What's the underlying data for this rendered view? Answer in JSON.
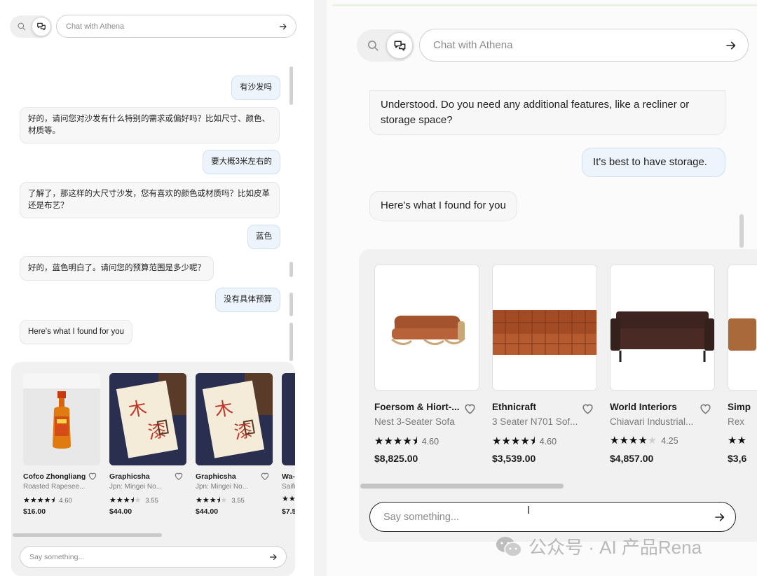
{
  "left": {
    "search_placeholder": "Chat with Athena",
    "messages": [
      {
        "role": "user",
        "text": "有沙发吗"
      },
      {
        "role": "bot",
        "text": "好的，请问您对沙发有什么特别的需求或偏好吗？比如尺寸、颜色、材质等。"
      },
      {
        "role": "user",
        "text": "要大概3米左右的"
      },
      {
        "role": "bot",
        "text": "了解了，那这样的大尺寸沙发，您有喜欢的颜色或材质吗？比如皮革还是布艺？"
      },
      {
        "role": "user",
        "text": "蓝色"
      },
      {
        "role": "bot",
        "text": "好的，蓝色明白了。请问您的预算范围是多少呢？"
      },
      {
        "role": "user",
        "text": "没有具体预算"
      },
      {
        "role": "bot",
        "text": "Here's what I found for you"
      }
    ],
    "products": [
      {
        "brand": "Cofco Zhongliang",
        "name": "Roasted Rapesee...",
        "stars": 4.5,
        "rating": "4.60",
        "price": "$16.00",
        "image": "oil-bottle"
      },
      {
        "brand": "Graphicsha",
        "name": "Jpn: Mingei No...",
        "stars": 3.5,
        "rating": "3.55",
        "price": "$44.00",
        "image": "book-cover"
      },
      {
        "brand": "Graphicsha",
        "name": "Jpn: Mingei No...",
        "stars": 3.5,
        "rating": "3.55",
        "price": "$44.00",
        "image": "book-cover"
      },
      {
        "brand": "Wa-",
        "name": "Saifu",
        "stars": 2,
        "rating": "",
        "price": "$7.5",
        "image": "book-cover"
      }
    ],
    "say_placeholder": "Say something..."
  },
  "right": {
    "search_placeholder": "Chat with Athena",
    "messages": [
      {
        "role": "bot",
        "text": "Understood. Do you need any additional features, like a recliner or storage space?"
      },
      {
        "role": "user",
        "text": "It's best to have storage."
      },
      {
        "role": "bot",
        "text": "Here's what I found for you"
      }
    ],
    "products": [
      {
        "brand": "Foersom & Hiort-...",
        "name": "Nest 3-Seater Sofa",
        "stars": 4.5,
        "rating": "4.60",
        "price": "$8,825.00",
        "image": "sofa-rattan"
      },
      {
        "brand": "Ethnicraft",
        "name": "3 Seater N701 Sof...",
        "stars": 4.5,
        "rating": "4.60",
        "price": "$3,539.00",
        "image": "sofa-tufted"
      },
      {
        "brand": "World Interiors",
        "name": "Chiavari Industrial...",
        "stars": 4,
        "rating": "4.25",
        "price": "$4,857.00",
        "image": "sofa-dark"
      },
      {
        "brand": "Simp",
        "name": "Rex",
        "stars": 2,
        "rating": "",
        "price": "$3,6",
        "image": "sofa-tan"
      }
    ],
    "say_placeholder": "Say something..."
  },
  "watermark": "公众号 · AI 产品Rena",
  "icons": {
    "search": "search-icon",
    "chat": "chat-bubbles-icon",
    "send": "arrow-right-icon",
    "favorite": "heart-outline-icon",
    "watermark": "wechat-icon"
  },
  "colors": {
    "user_bubble": "#eef4fc",
    "bot_bubble": "#f7f7f7",
    "tray": "#f1f1f1"
  }
}
